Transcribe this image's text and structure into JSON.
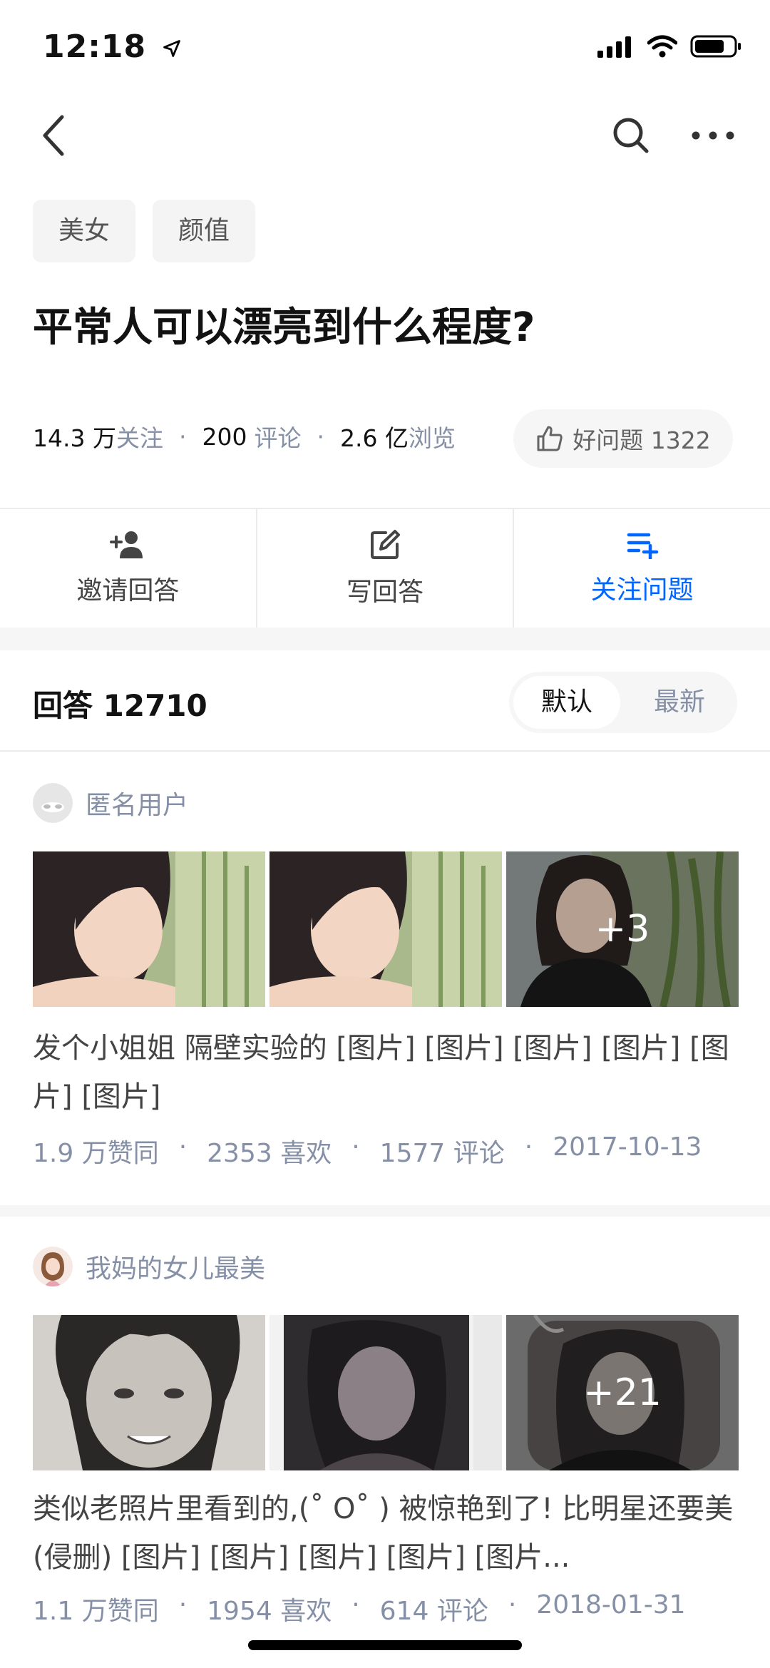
{
  "status": {
    "time": "12:18"
  },
  "tags": [
    "美女",
    "颜值"
  ],
  "question": {
    "title": "平常人可以漂亮到什么程度?",
    "follow_count": "14.3 万",
    "follow_label": "关注",
    "comment_count": "200",
    "comment_label": "评论",
    "view_count": "2.6 亿",
    "view_label": "浏览",
    "good_question_label": "好问题 1322"
  },
  "actions": {
    "invite": "邀请回答",
    "write": "写回答",
    "follow": "关注问题"
  },
  "answers_header": {
    "title": "回答 12710",
    "sort_default": "默认",
    "sort_latest": "最新"
  },
  "answers": [
    {
      "author": "匿名用户",
      "more_images": "+3",
      "excerpt": "发个小姐姐 隔壁实验的 [图片] [图片] [图片] [图片] [图片] [图片]",
      "votes": "1.9 万赞同",
      "likes": "2353 喜欢",
      "comments": "1577 评论",
      "date": "2017-10-13"
    },
    {
      "author": "我妈的女儿最美",
      "more_images": "+21",
      "excerpt": "类似老照片里看到的,(˚ O˚ ) 被惊艳到了! 比明星还要美 (侵删) [图片] [图片] [图片] [图片] [图片...",
      "votes": "1.1 万赞同",
      "likes": "1954 喜欢",
      "comments": "614 评论",
      "date": "2018-01-31"
    }
  ],
  "colors": {
    "accent": "#0066ff",
    "muted": "#8590a6",
    "band": "#f6f6f6"
  }
}
